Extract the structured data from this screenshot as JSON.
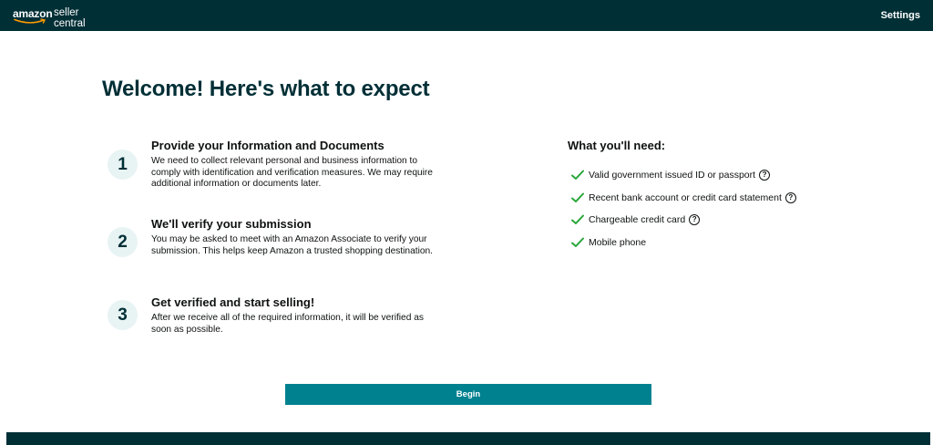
{
  "header": {
    "logo_brand": "amazon",
    "logo_product": "seller central",
    "settings_label": "Settings"
  },
  "main": {
    "title": "Welcome! Here's what to expect",
    "steps": [
      {
        "number": "1",
        "title": "Provide your Information and Documents",
        "description": "We need to collect relevant personal and business information to comply with identification and verification measures. We may require additional information or documents later."
      },
      {
        "number": "2",
        "title": "We'll verify your submission",
        "description": "You may be asked to meet with an Amazon Associate to verify your submission. This helps keep Amazon a trusted shopping destination."
      },
      {
        "number": "3",
        "title": "Get verified and start selling!",
        "description": "After we receive all of the required information, it will be verified as soon as possible."
      }
    ],
    "needs": {
      "title": "What you'll need:",
      "items": [
        {
          "label": "Valid government issued ID or passport",
          "has_help": true
        },
        {
          "label": "Recent bank account or credit card statement",
          "has_help": true
        },
        {
          "label": "Chargeable credit card",
          "has_help": true
        },
        {
          "label": "Mobile phone",
          "has_help": false
        }
      ],
      "check_icon": "check-icon",
      "help_icon": "question-circle-icon",
      "help_glyph": "?"
    },
    "begin_label": "Begin"
  },
  "colors": {
    "header_bg": "#002f36",
    "title": "#002f36",
    "badge_bg": "#e8f3f4",
    "check": "#2aa63b",
    "button_bg": "#00818f"
  }
}
